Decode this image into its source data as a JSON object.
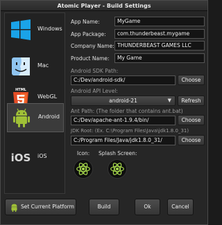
{
  "window": {
    "title": "Atomic Player - Build Settings"
  },
  "platforms": [
    {
      "label": "Windows",
      "icon": "windows-icon"
    },
    {
      "label": "Mac",
      "icon": "mac-finder-icon"
    },
    {
      "label": "WebGL",
      "icon": "html5-icon"
    },
    {
      "label": "Android",
      "icon": "android-icon",
      "selected": true
    },
    {
      "label": "iOS",
      "icon": "ios-icon"
    }
  ],
  "settings": {
    "app_name_label": "App Name:",
    "app_name_value": "MyGame",
    "app_package_label": "App Package:",
    "app_package_value": "com.thunderbeast.mygame",
    "company_name_label": "Company Name:",
    "company_name_value": "THUNDERBEAST GAMES LLC",
    "product_name_label": "Product Name:",
    "product_name_value": "My Game",
    "sdk_path_label": "Android SDK Path:",
    "sdk_path_value": "C:/Dev/android-sdk/",
    "api_level_label": "Android API Level:",
    "api_level_value": "android-21",
    "ant_path_label": "Ant Path: (The folder that contains ant.bat)",
    "ant_path_value": "C:/Dev/apache-ant-1.9.4/bin/",
    "jdk_root_label": "JDK Root: (Ex. C:\\Program Files\\Java\\jdk1.8.0_31)",
    "jdk_root_value": "C:/Program Files/Java/jdk1.8.0_31/",
    "choose_label": "Choose",
    "refresh_label": "Refresh",
    "icon_label": "Icon:",
    "splash_label": "Splash Screen:"
  },
  "footer": {
    "set_current_platform_label": "Set Current Platform",
    "build_label": "Build",
    "ok_label": "Ok",
    "cancel_label": "Cancel"
  },
  "colors": {
    "atom_green": "#a6d84b",
    "windows_blue": "#1aa3e8",
    "html5_orange": "#e44d26",
    "android_green": "#9fc037"
  }
}
